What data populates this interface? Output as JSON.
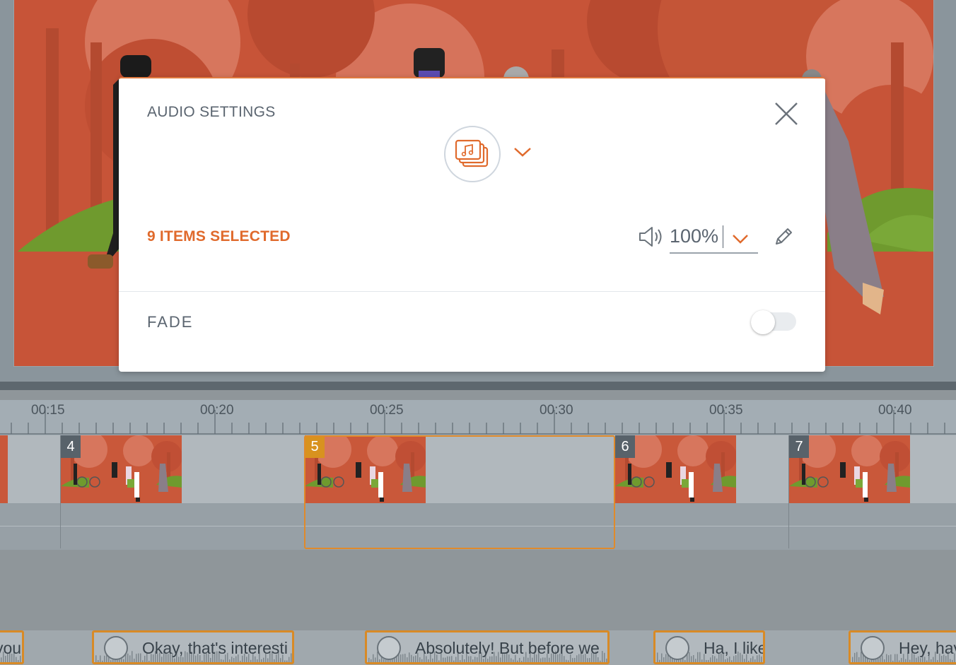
{
  "modal": {
    "title": "AUDIO SETTINGS",
    "selection_text": "9 ITEMS SELECTED",
    "volume_value": "100%",
    "fade_label": "FADE",
    "fade_enabled": false,
    "icons": {
      "close": "close-icon",
      "asset_type": "music-stack-icon",
      "speaker": "speaker-icon",
      "edit": "pencil-icon"
    },
    "accent_color": "#e06a2c"
  },
  "timeline": {
    "ruler_labels": [
      "00:15",
      "00:20",
      "00:25",
      "00:30",
      "00:35",
      "00:40"
    ],
    "scenes": [
      {
        "badge": "4",
        "selected": false
      },
      {
        "badge": "5",
        "selected": true
      },
      {
        "badge": "6",
        "selected": false
      },
      {
        "badge": "7",
        "selected": false
      }
    ],
    "audio_clips": [
      {
        "text": "you"
      },
      {
        "text": "Okay, that's interesti"
      },
      {
        "text": "Absolutely! But before we"
      },
      {
        "text": "Ha, I like"
      },
      {
        "text": "Hey, hav"
      }
    ],
    "selection_color": "#e08a2a"
  }
}
